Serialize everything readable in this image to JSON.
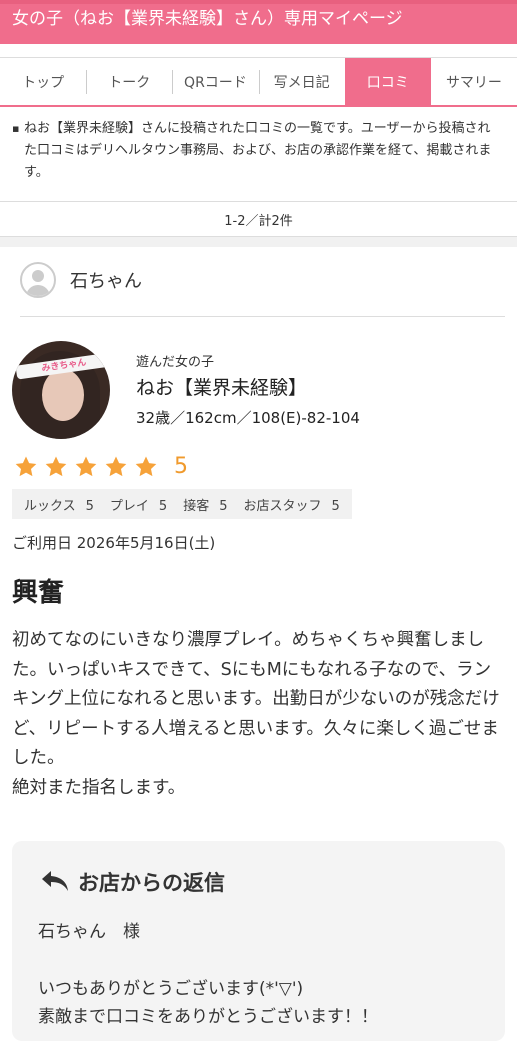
{
  "header": {
    "title": "女の子（ねお【業界未経験】さん）専用マイページ"
  },
  "tabs": [
    {
      "label": "トップ"
    },
    {
      "label": "トーク"
    },
    {
      "label": "QRコード"
    },
    {
      "label": "写メ日記"
    },
    {
      "label": "口コミ",
      "active": true
    },
    {
      "label": "サマリー"
    }
  ],
  "notice": "ねお【業界未経験】さんに投稿された口コミの一覧です。ユーザーから投稿された口コミはデリヘルタウン事務局、および、お店の承認作業を経て、掲載されます。",
  "pager": "1-2／計2件",
  "review": {
    "reviewer_name": "石ちゃん",
    "girl_label": "遊んだ女の子",
    "girl_name": "ねお【業界未経験】",
    "girl_spec": "32歳／162cm／108(E)-82-104",
    "photo_band_text": "みきちゃん",
    "rating": 5,
    "rating_text": "5",
    "star_color": "#f6a23a",
    "subscores": [
      {
        "label": "ルックス",
        "value": "5"
      },
      {
        "label": "プレイ",
        "value": "5"
      },
      {
        "label": "接客",
        "value": "5"
      },
      {
        "label": "お店スタッフ",
        "value": "5"
      }
    ],
    "date": "ご利用日 2026年5月16日(土)",
    "title": "興奮",
    "body": "初めてなのにいきなり濃厚プレイ。めちゃくちゃ興奮しました。いっぱいキスできて、SにもMにもなれる子なので、ランキング上位になれると思います。出勤日が少ないのが残念だけど、リピートする人増えると思います。久々に楽しく過ごせました。\n絶対また指名します。"
  },
  "reply": {
    "heading": "お店からの返信",
    "to": "石ちゃん　様",
    "text": "いつもありがとうございます(*'▽')\n素敵まで口コミをありがとうございます！！"
  },
  "colors": {
    "accent": "#f06d8c",
    "star": "#f6a23a"
  }
}
